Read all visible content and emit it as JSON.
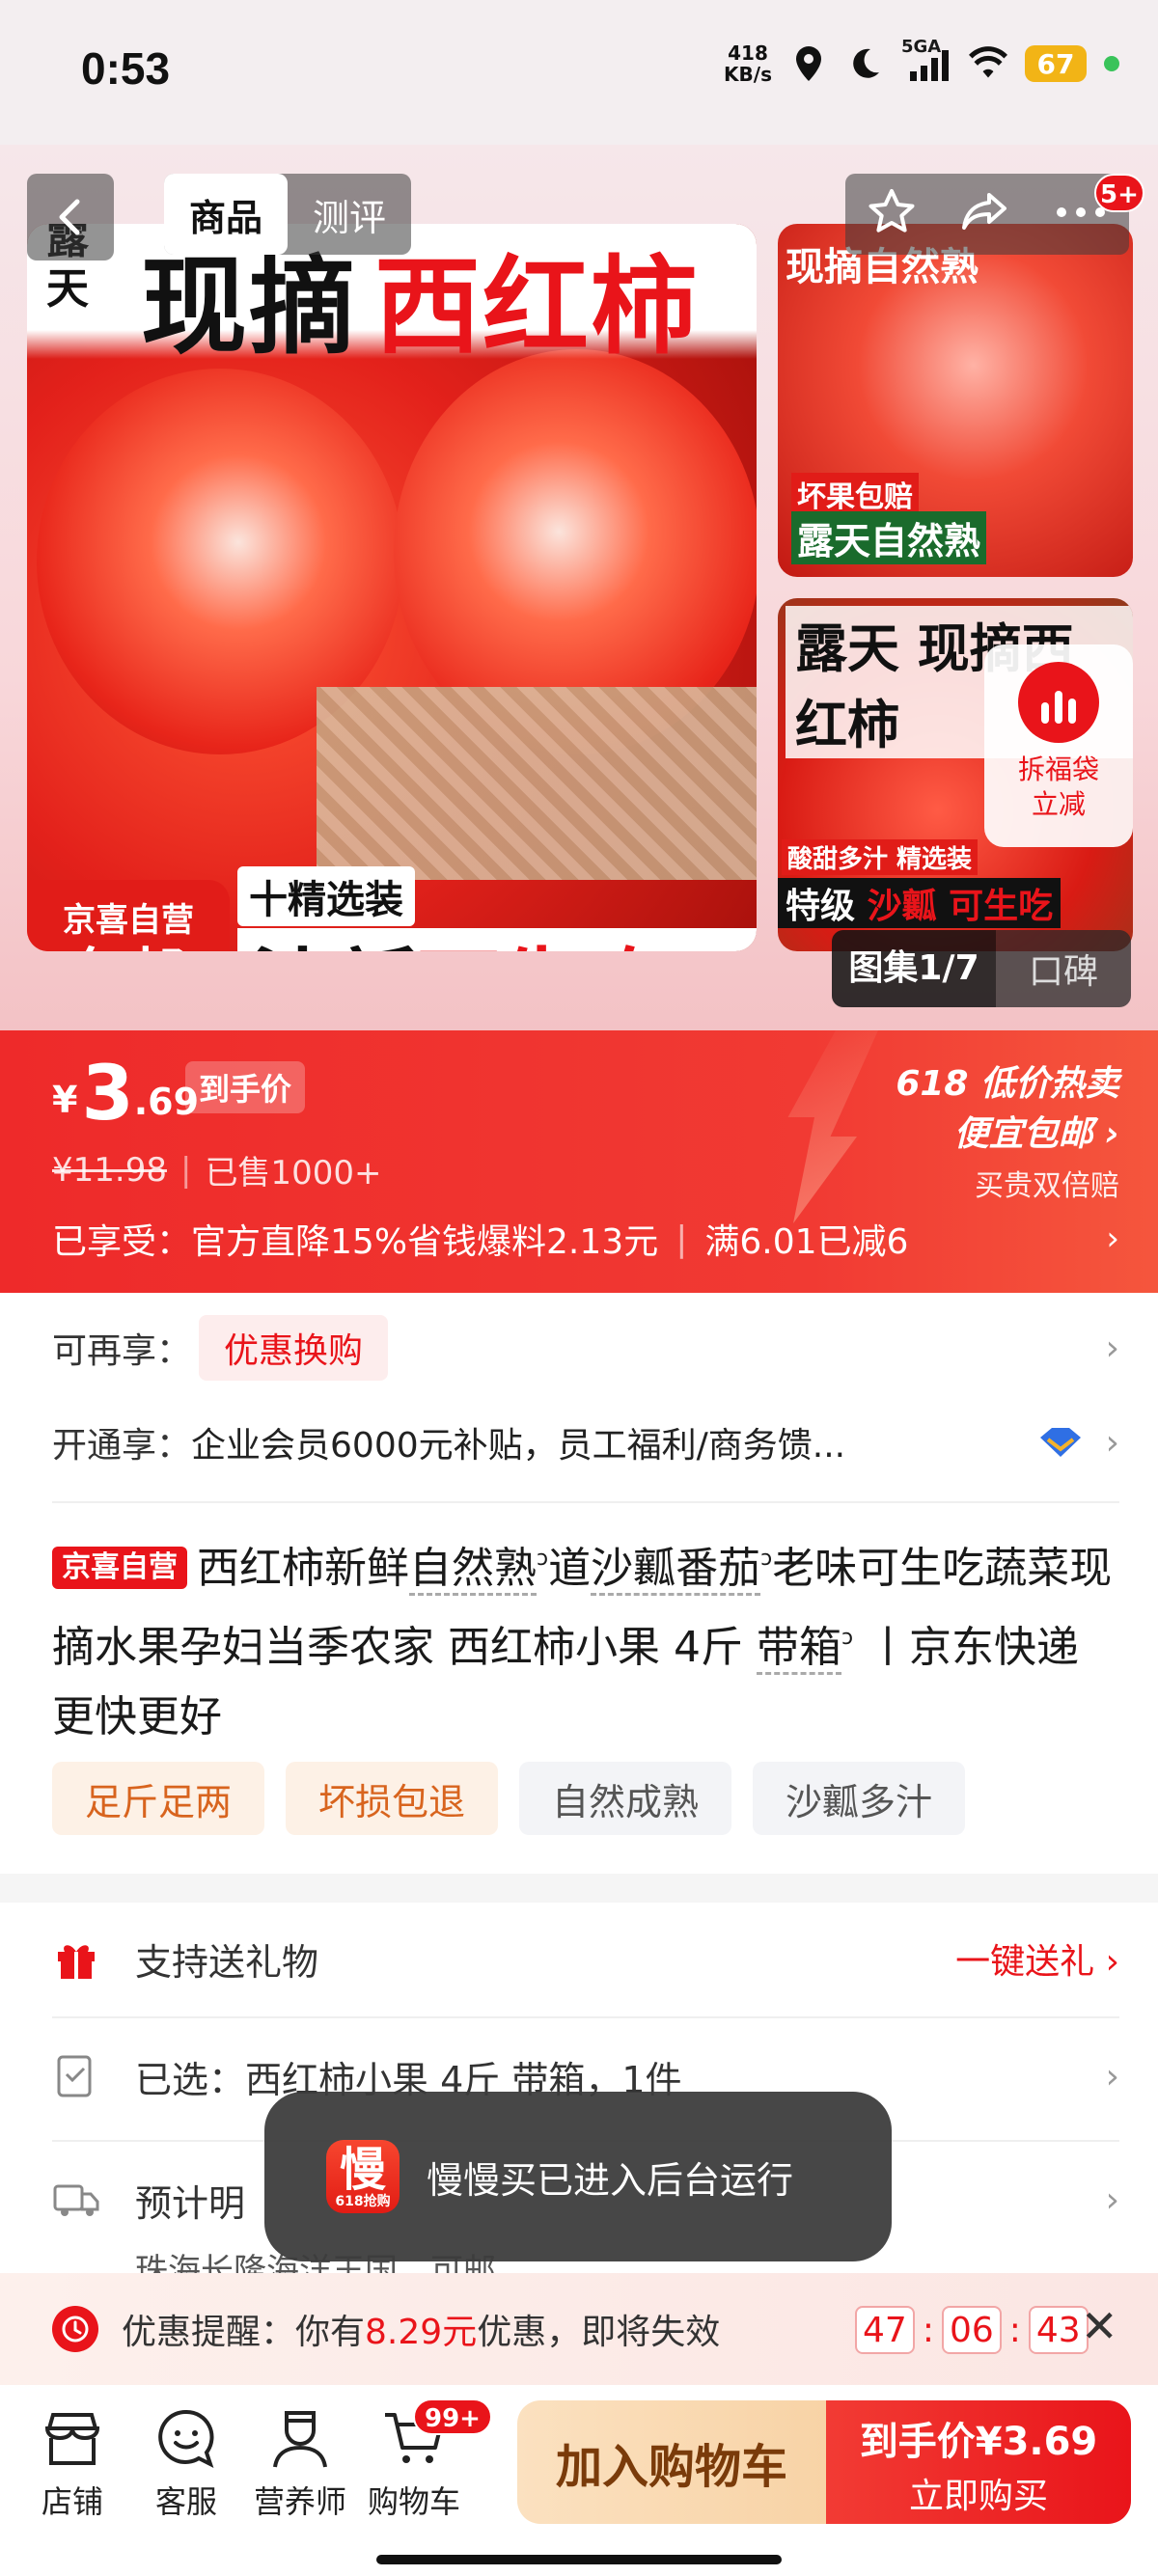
{
  "status_bar": {
    "time": "0:53",
    "net_speed_value": "418",
    "net_speed_unit": "KB/s",
    "signal_label": "5GA",
    "battery": "67",
    "battery_color": "#f2b416"
  },
  "nav": {
    "tabs": [
      "商品",
      "测评"
    ],
    "message_badge": "5+"
  },
  "gallery": {
    "headline_vertical": "露天",
    "headline_black": "现摘",
    "headline_red": "西红柿",
    "badge_line1": "京喜自营",
    "badge_line2": "包邮",
    "select_tag": "十精选装",
    "slogan_black": "沙瓤",
    "slogan_red": "可生吃",
    "side1_title": "现摘自然熟",
    "side1_tag1": "坏果包赔",
    "side1_tag2": "露天自然熟",
    "side2_title": "露天 现摘西红柿",
    "side2_foot_black": "特级",
    "side2_foot_label": "酸甜多汁 精选装",
    "side2_foot_red": "沙瓤 可生吃",
    "gallery_label": "图集1/7",
    "reviews_label": "口碑",
    "float_line1": "拆福袋",
    "float_line2": "立减"
  },
  "price": {
    "yen": "¥",
    "int": "3",
    "dec": ".69",
    "hand_price_label": "到手价",
    "original": "¥11.98",
    "sold": "已售1000+",
    "promo_line1": "618 低价热卖",
    "promo_line2": "便宜包邮 ›",
    "promo_line3": "买贵双倍赔",
    "enjoy_label": "已享受：",
    "enjoy_text1": "官方直降15%省钱爆料2.13元",
    "enjoy_text2": "满6.01已减6",
    "accent_color": "#e9141a"
  },
  "offers": {
    "row1_label": "可再享：",
    "row1_chip": "优惠换购",
    "row2_label": "开通享：",
    "row2_text": "企业会员6000元补贴，员工福利/商务馈..."
  },
  "title": {
    "self_tag": "京喜自营",
    "part1": "西红柿新鲜",
    "kw1": "自然熟",
    "part2": "道",
    "kw2": "沙瓤番茄",
    "part3": "老味可生吃蔬菜现摘水果孕妇当季农家 西红柿小果 4斤 ",
    "kw3": "带箱",
    "part4": " 丨京东快递 更快更好"
  },
  "tags": [
    "足斤足两",
    "坏损包退",
    "自然成熟",
    "沙瓤多汁"
  ],
  "list": {
    "gift_label": "支持送礼物",
    "gift_action": "一键送礼 ›",
    "selected_label": "已选：西红柿小果 4斤 带箱，1件",
    "delivery_label": "预计明",
    "delivery_sub": "珠海长隆海洋王国，可邮"
  },
  "toast": {
    "app_glyph": "慢",
    "app_sub": "618抢购",
    "message": "慢慢买已进入后台运行"
  },
  "reminder": {
    "label": "优惠提醒：",
    "text1": "你有",
    "amount": "8.29元",
    "text2": "优惠，即将失效",
    "h": "47",
    "m": "06",
    "s": "43",
    "colon": ":"
  },
  "bottom": {
    "store": "店铺",
    "service": "客服",
    "nutritionist": "营养师",
    "cart": "购物车",
    "cart_badge": "99+",
    "add_cart": "加入购物车",
    "buy_line1": "到手价¥3.69",
    "buy_line2": "立即购买"
  }
}
